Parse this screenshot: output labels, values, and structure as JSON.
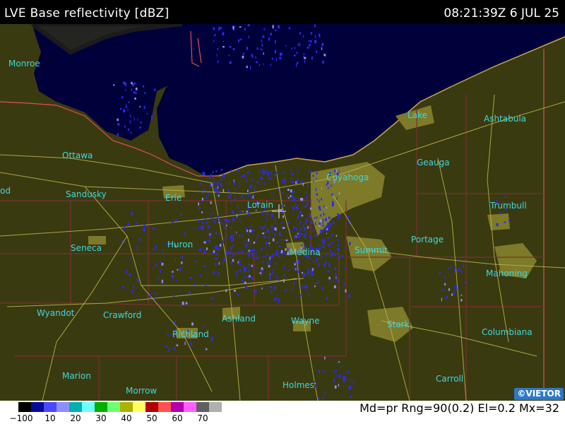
{
  "header": {
    "title": "LVE Base reflectivity [dBZ]",
    "timestamp": "08:21:39Z  6 JUL 25"
  },
  "map": {
    "counties": [
      "Monroe",
      "Ottawa",
      "Sandusky",
      "Erie",
      "Lorain",
      "Cuyahoga",
      "Lake",
      "Ashtabula",
      "Geauga",
      "Trumbull",
      "Portage",
      "Summit",
      "Medina",
      "Huron",
      "Seneca",
      "Wyandot",
      "Crawford",
      "Richland",
      "Ashland",
      "Wayne",
      "Stark",
      "Mahoning",
      "Columbiana",
      "Carroll",
      "Holmes",
      "Morrow",
      "Marion",
      "od"
    ],
    "colors": {
      "land": "#3a3a10",
      "lake": "#00003a",
      "urban": "#7d7a2a",
      "county_border": "#7a3030",
      "state_border": "#e05050",
      "roads": "#b9b04a",
      "echo": "#2a2aff",
      "label": "#3fd7dd"
    }
  },
  "credit": "©VIETOR",
  "legend": {
    "colors": [
      "#000000",
      "#0a0a9a",
      "#4848ff",
      "#8e8eff",
      "#00b0b0",
      "#70ffff",
      "#00b000",
      "#70ff70",
      "#b0b000",
      "#ffff60",
      "#b00000",
      "#ff5050",
      "#b000b0",
      "#ff60ff",
      "#606060",
      "#b0b0b0",
      "#ffffff"
    ],
    "ticks": [
      "−100",
      "10",
      "20",
      "30",
      "40",
      "50",
      "60",
      "70"
    ]
  },
  "params": "Md=pr Rng=90(0.2) El=0.2 Mx=32"
}
